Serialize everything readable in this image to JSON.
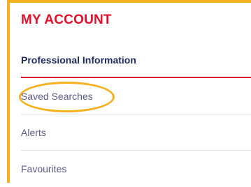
{
  "account": {
    "title": "MY ACCOUNT",
    "items": [
      {
        "label": "Professional Information",
        "active": true
      },
      {
        "label": "Saved Searches",
        "highlighted": true
      },
      {
        "label": "Alerts"
      },
      {
        "label": "Favourites"
      }
    ]
  },
  "colors": {
    "accent": "#e0112b",
    "highlight": "#f5b120",
    "active_text": "#1d2a5c",
    "item_text": "#5a5a86"
  }
}
